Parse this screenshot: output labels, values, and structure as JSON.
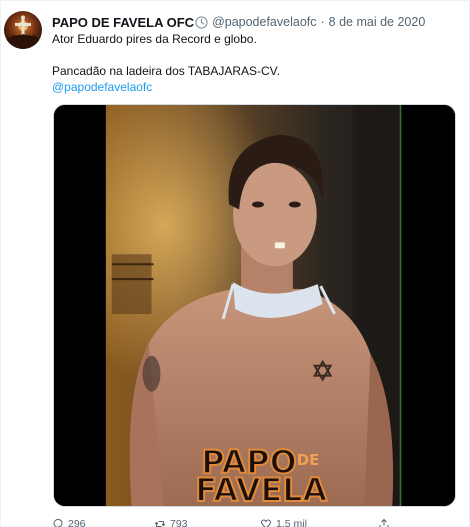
{
  "tweet": {
    "display_name": "PAPO DE FAVELA OFC",
    "handle": "@papodefavelaofc",
    "separator": "·",
    "date": "8 de mai de 2020",
    "line1": "Ator Eduardo pires da Record e globo.",
    "line2": "Pancadão na ladeira dos TABAJARAS-CV.",
    "mention": "@papodefavelaofc",
    "badge_icon": "clock-badge-icon"
  },
  "media": {
    "watermark_line1": "PAPO",
    "watermark_small": "DE",
    "watermark_line2": "FAVELA"
  },
  "actions": {
    "replies": "296",
    "retweets": "793",
    "likes": "1,5 mil",
    "reply_icon": "reply-icon",
    "retweet_icon": "retweet-icon",
    "like_icon": "heart-icon",
    "share_icon": "share-icon"
  },
  "colors": {
    "accent": "#1d9bf0",
    "secondary_text": "#536471"
  }
}
